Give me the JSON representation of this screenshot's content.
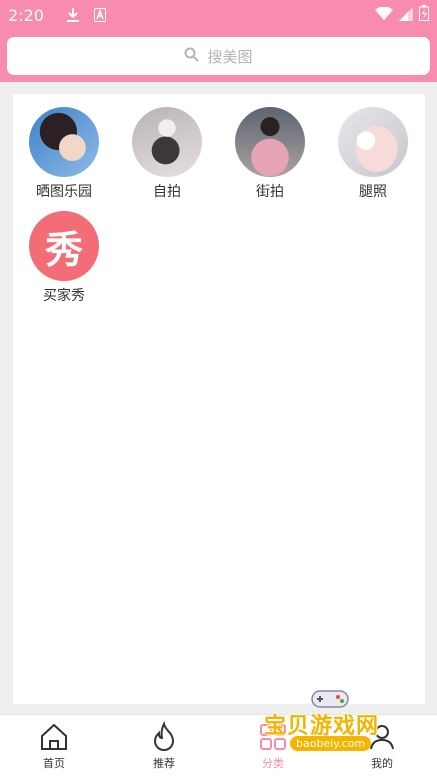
{
  "status_bar": {
    "time": "2:20"
  },
  "search": {
    "placeholder": "搜美图"
  },
  "categories": [
    {
      "label": "晒图乐园"
    },
    {
      "label": "自拍"
    },
    {
      "label": "街拍"
    },
    {
      "label": "腿照"
    },
    {
      "label": "买家秀",
      "glyph": "秀"
    }
  ],
  "bottom_nav": {
    "items": [
      {
        "label": "首页",
        "icon": "home-icon"
      },
      {
        "label": "推荐",
        "icon": "flame-icon"
      },
      {
        "label": "分类",
        "icon": "category-icon",
        "active": true
      },
      {
        "label": "我的",
        "icon": "user-icon"
      }
    ],
    "active_color": "#f88cae"
  },
  "watermark": {
    "title": "宝贝游戏网",
    "url": "baobeiy.com"
  },
  "colors": {
    "brand": "#f88cae",
    "xiu_badge": "#f26d75"
  }
}
